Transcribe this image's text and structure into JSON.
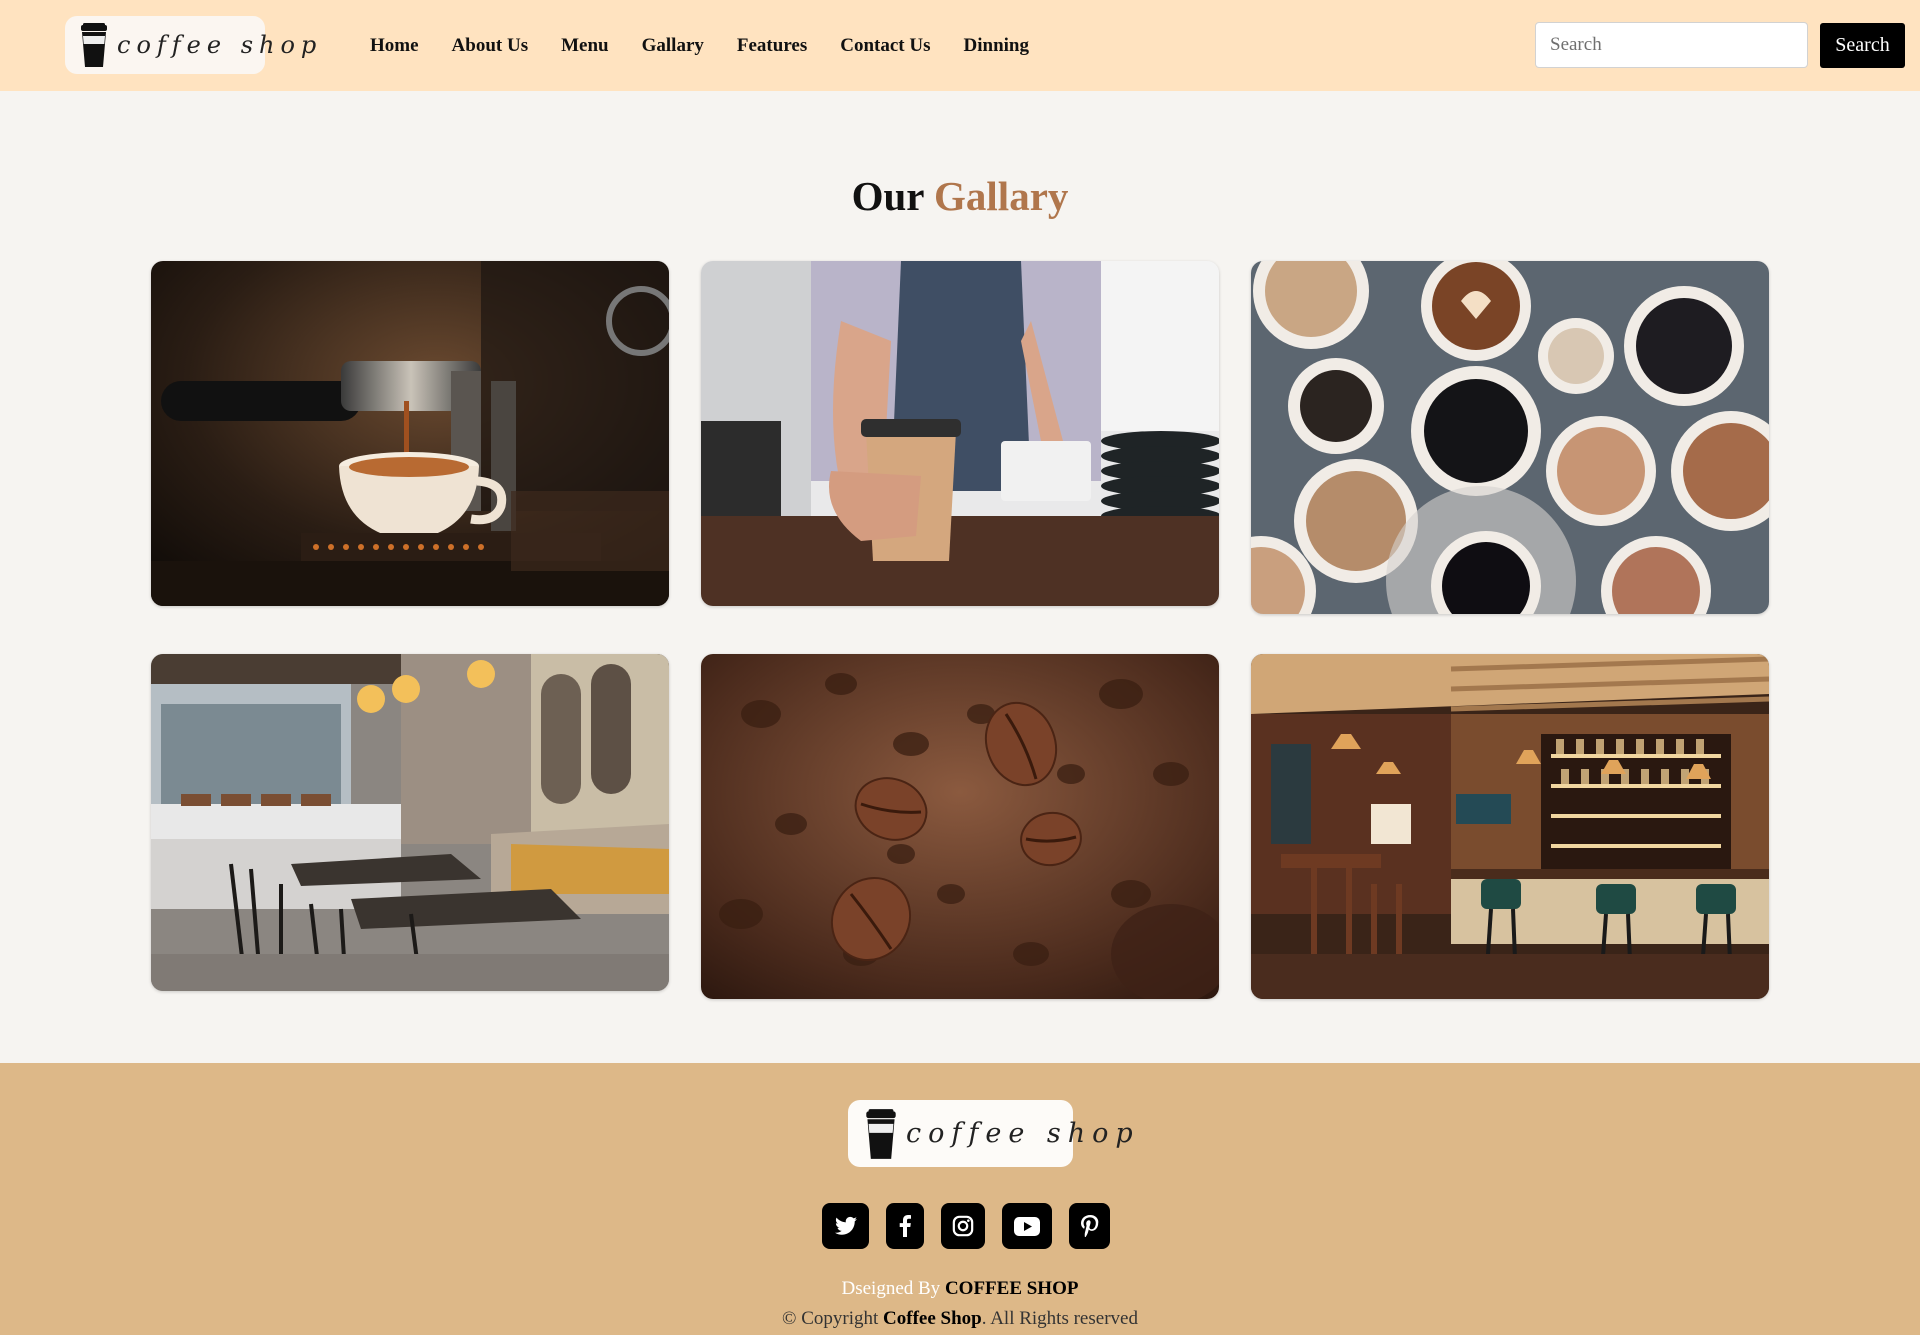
{
  "header": {
    "logo_text": "coffee shop",
    "nav": [
      "Home",
      "About Us",
      "Menu",
      "Gallary",
      "Features",
      "Contact Us",
      "Dinning"
    ],
    "search_placeholder": "Search",
    "search_button": "Search"
  },
  "gallery": {
    "title_plain": "Our",
    "title_accent": "Gallary",
    "accent_color": "#b0764c",
    "images": [
      {
        "subject": "espresso machine pouring into cup"
      },
      {
        "subject": "barista handing takeaway cup"
      },
      {
        "subject": "top view of coffee cups"
      },
      {
        "subject": "cafe interior with tables"
      },
      {
        "subject": "flying coffee beans"
      },
      {
        "subject": "bar interior with stools"
      }
    ]
  },
  "footer": {
    "logo_text": "coffee shop",
    "social": [
      {
        "icon": "twitter-icon"
      },
      {
        "icon": "facebook-icon"
      },
      {
        "icon": "instagram-icon"
      },
      {
        "icon": "youtube-icon"
      },
      {
        "icon": "pinterest-icon"
      }
    ],
    "designed_prefix": "Dseigned By",
    "designed_by": "COFFEE SHOP",
    "copyright_prefix": "© Copyright",
    "copyright_brand": "Coffee Shop",
    "copyright_suffix": ". All Rights reserved"
  },
  "colors": {
    "header_bg": "#ffe3c0",
    "page_bg": "#f6f4f1",
    "footer_bg": "#ddb888"
  }
}
